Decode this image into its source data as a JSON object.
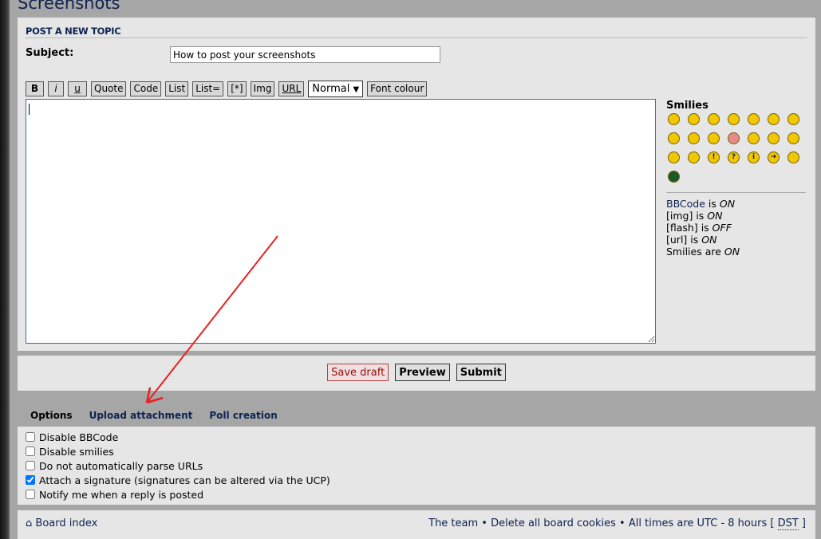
{
  "page_title": "Screenshots",
  "panel_title": "POST A NEW TOPIC",
  "subject": {
    "label": "Subject:",
    "value": "How to post your screenshots"
  },
  "toolbar": {
    "buttons": [
      "B",
      "i",
      "u",
      "Quote",
      "Code",
      "List",
      "List=",
      "[*]",
      "Img",
      "URL"
    ],
    "font_size": "Normal",
    "font_colour": "Font colour"
  },
  "smilies": {
    "title": "Smilies",
    "icons": [
      "very-happy",
      "smile",
      "sad",
      "surprised",
      "shocked",
      "confused",
      "cool",
      "laughing",
      "mad",
      "razz",
      "embarrassed",
      "crying",
      "evil",
      "twisted-evil",
      "rolling-eyes",
      "wink",
      "exclamation",
      "question",
      "idea",
      "arrow",
      "neutral",
      "mr-green"
    ]
  },
  "bbinfo": [
    {
      "a": "BBCode",
      "b": " is ",
      "c": "ON"
    },
    {
      "a": "[img]",
      "b": " is ",
      "c": "ON"
    },
    {
      "a": "[flash]",
      "b": " is ",
      "c": "OFF"
    },
    {
      "a": "[url]",
      "b": " is ",
      "c": "ON"
    },
    {
      "a": "Smilies",
      "b": " are ",
      "c": "ON"
    }
  ],
  "actions": {
    "save_draft": "Save draft",
    "preview": "Preview",
    "submit": "Submit"
  },
  "tabs": [
    "Options",
    "Upload attachment",
    "Poll creation"
  ],
  "options": [
    {
      "label": "Disable BBCode",
      "checked": false
    },
    {
      "label": "Disable smilies",
      "checked": false
    },
    {
      "label": "Do not automatically parse URLs",
      "checked": false
    },
    {
      "label": "Attach a signature (signatures can be altered via the UCP)",
      "checked": true
    },
    {
      "label": "Notify me when a reply is posted",
      "checked": false
    }
  ],
  "footer": {
    "board_index": "Board index",
    "the_team": "The team",
    "delete_cookies": "Delete all board cookies",
    "times": "All times are UTC - 8 hours [",
    "dst": "DST",
    "close": "]"
  },
  "colors": {
    "accent": "#0d2350",
    "annotation_arrow": "#e82020"
  }
}
